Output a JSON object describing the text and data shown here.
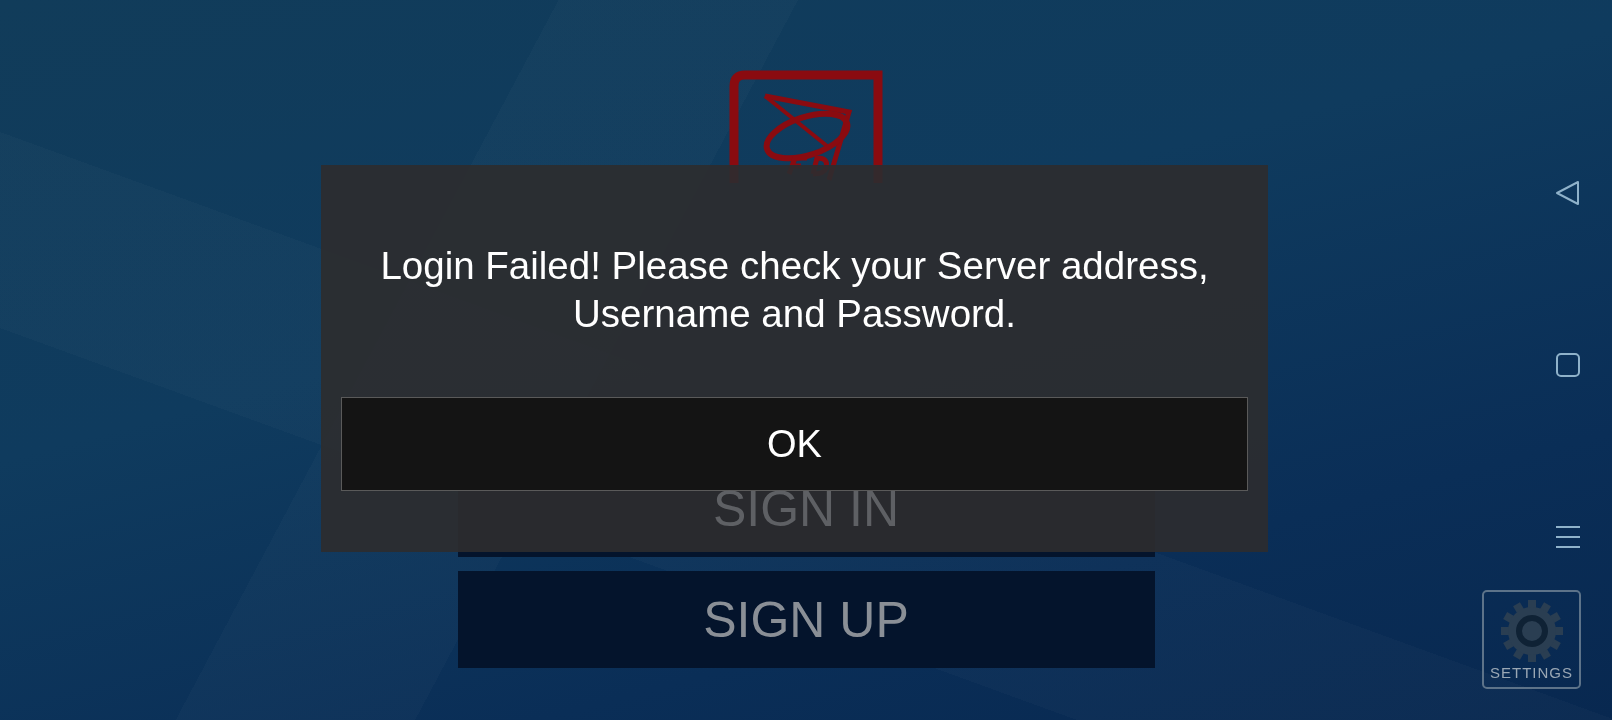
{
  "login_form": {
    "buttons": [
      "SIGN IN",
      "SIGN UP"
    ]
  },
  "settings_button": {
    "label": "SETTINGS"
  },
  "dialog": {
    "message": "Login Failed! Please check your Server address, Username and Password.",
    "buttons": [
      "OK"
    ]
  }
}
